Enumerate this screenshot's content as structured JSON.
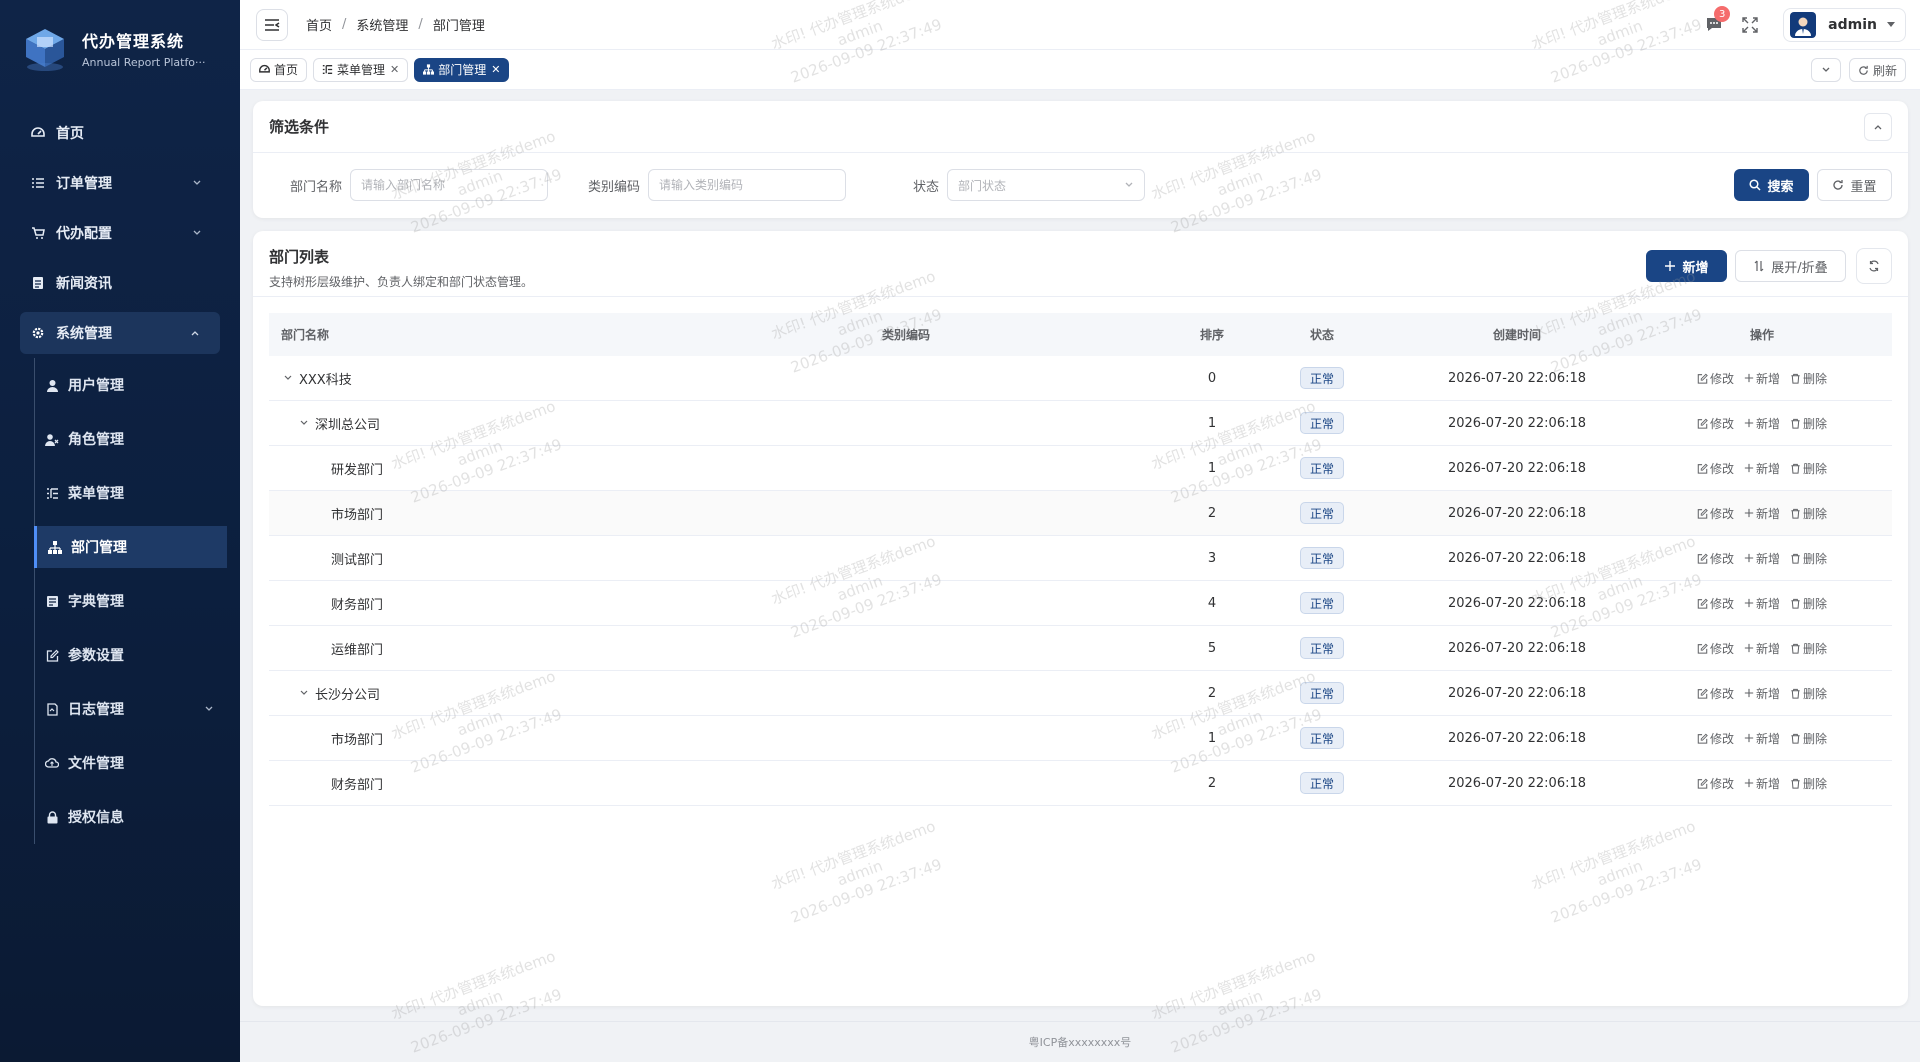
{
  "app": {
    "title": "代办管理系统",
    "subtitle": "Annual Report Platfo···"
  },
  "sidebar": {
    "items": [
      {
        "label": "首页",
        "icon": "dashboard-icon"
      },
      {
        "label": "订单管理",
        "icon": "list-icon",
        "arrow": "down"
      },
      {
        "label": "代办配置",
        "icon": "cart-icon",
        "arrow": "down"
      },
      {
        "label": "新闻资讯",
        "icon": "document-icon"
      },
      {
        "label": "系统管理",
        "icon": "gear-icon",
        "arrow": "up",
        "expanded": true
      }
    ],
    "submenu": [
      {
        "label": "用户管理",
        "icon": "user-icon"
      },
      {
        "label": "角色管理",
        "icon": "role-icon"
      },
      {
        "label": "菜单管理",
        "icon": "menu-tree-icon"
      },
      {
        "label": "部门管理",
        "icon": "org-chart-icon",
        "active": true
      },
      {
        "label": "字典管理",
        "icon": "dictionary-icon"
      },
      {
        "label": "参数设置",
        "icon": "edit-icon"
      },
      {
        "label": "日志管理",
        "icon": "log-icon",
        "arrow": "down"
      },
      {
        "label": "文件管理",
        "icon": "cloud-icon"
      },
      {
        "label": "授权信息",
        "icon": "lock-icon"
      }
    ]
  },
  "header": {
    "breadcrumb": [
      "首页",
      "系统管理",
      "部门管理"
    ],
    "notifications_count": "3",
    "username": "admin"
  },
  "tabs": [
    {
      "label": "首页",
      "icon": "dashboard-icon",
      "closable": false,
      "active": false
    },
    {
      "label": "菜单管理",
      "icon": "menu-tree-icon",
      "closable": true,
      "active": false
    },
    {
      "label": "部门管理",
      "icon": "org-chart-icon",
      "closable": true,
      "active": true
    }
  ],
  "tabs_actions": {
    "refresh_label": "刷新"
  },
  "filter": {
    "title": "筛选条件",
    "dept_name_label": "部门名称",
    "dept_name_placeholder": "请输入部门名称",
    "category_label": "类别编码",
    "category_placeholder": "请输入类别编码",
    "status_label": "状态",
    "status_placeholder": "部门状态",
    "search_label": "搜索",
    "reset_label": "重置"
  },
  "list": {
    "title": "部门列表",
    "subtitle": "支持树形层级维护、负责人绑定和部门状态管理。",
    "add_label": "新增",
    "expand_label": "展开/折叠",
    "columns": [
      "部门名称",
      "类别编码",
      "排序",
      "状态",
      "创建时间",
      "操作"
    ],
    "ops": {
      "edit": "修改",
      "add": "新增",
      "delete": "删除"
    },
    "rows": [
      {
        "name": "XXX科技",
        "level": 0,
        "caret": true,
        "code": "",
        "sort": "0",
        "status": "正常",
        "time": "2026-07-20 22:06:18"
      },
      {
        "name": "深圳总公司",
        "level": 1,
        "caret": true,
        "code": "",
        "sort": "1",
        "status": "正常",
        "time": "2026-07-20 22:06:18"
      },
      {
        "name": "研发部门",
        "level": 2,
        "caret": false,
        "code": "",
        "sort": "1",
        "status": "正常",
        "time": "2026-07-20 22:06:18"
      },
      {
        "name": "市场部门",
        "level": 2,
        "caret": false,
        "code": "",
        "sort": "2",
        "status": "正常",
        "time": "2026-07-20 22:06:18"
      },
      {
        "name": "测试部门",
        "level": 2,
        "caret": false,
        "code": "",
        "sort": "3",
        "status": "正常",
        "time": "2026-07-20 22:06:18"
      },
      {
        "name": "财务部门",
        "level": 2,
        "caret": false,
        "code": "",
        "sort": "4",
        "status": "正常",
        "time": "2026-07-20 22:06:18"
      },
      {
        "name": "运维部门",
        "level": 2,
        "caret": false,
        "code": "",
        "sort": "5",
        "status": "正常",
        "time": "2026-07-20 22:06:18"
      },
      {
        "name": "长沙分公司",
        "level": 1,
        "caret": true,
        "code": "",
        "sort": "2",
        "status": "正常",
        "time": "2026-07-20 22:06:18"
      },
      {
        "name": "市场部门",
        "level": 2,
        "caret": false,
        "code": "",
        "sort": "1",
        "status": "正常",
        "time": "2026-07-20 22:06:18"
      },
      {
        "name": "财务部门",
        "level": 2,
        "caret": false,
        "code": "",
        "sort": "2",
        "status": "正常",
        "time": "2026-07-20 22:06:18"
      }
    ]
  },
  "footer": {
    "icp": "粤ICP备xxxxxxxx号"
  },
  "watermark": {
    "line1": "水印! 代办管理系统demo",
    "line2": "admin",
    "line3": "2026-09-09 22:37:49"
  },
  "colors": {
    "primary": "#1a4585",
    "sidebar_bg": "#0f2447",
    "badge": "#f56c6c"
  }
}
